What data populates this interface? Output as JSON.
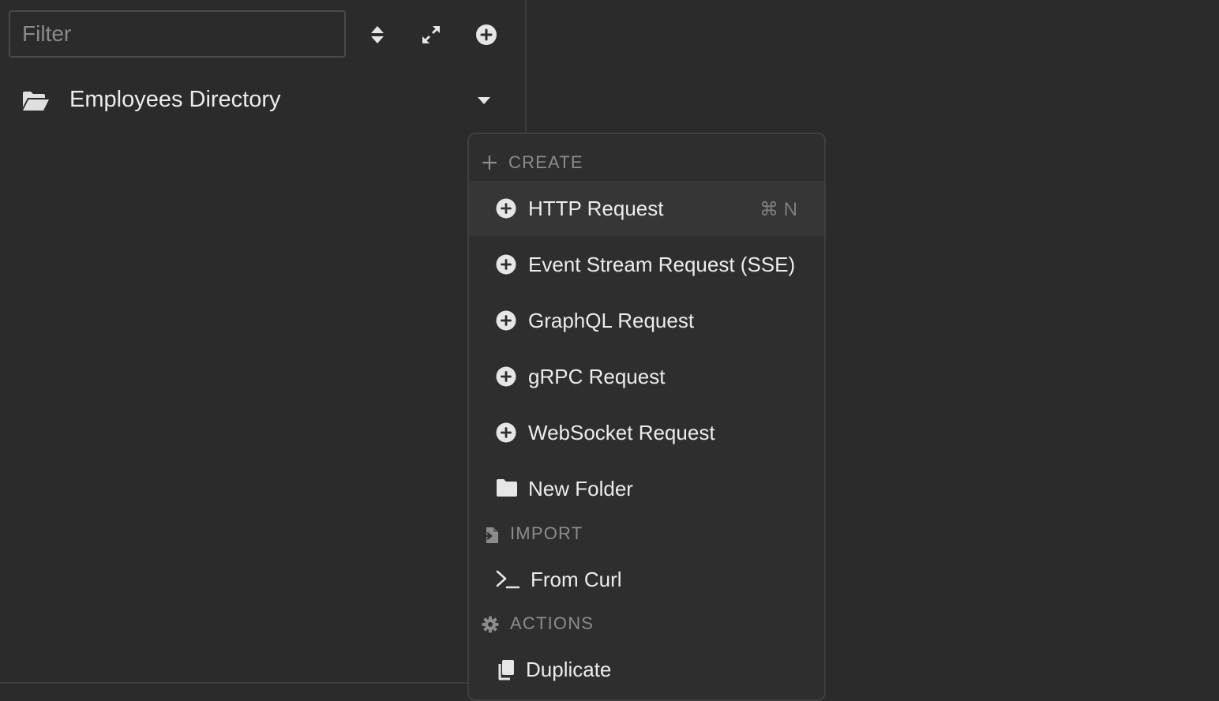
{
  "sidebar": {
    "filter_placeholder": "Filter",
    "toolbar": {
      "sort_icon": "sort-updown-icon",
      "expand_icon": "expand-arrows-icon",
      "add_icon": "plus-circle-icon"
    },
    "collection": {
      "icon": "folder-open-icon",
      "title": "Employees Directory",
      "toggle_icon": "caret-down-icon"
    }
  },
  "menu": {
    "create": {
      "label": "CREATE",
      "icon": "plus-icon",
      "items": [
        {
          "label": "HTTP Request",
          "icon": "plus-circle-icon",
          "shortcut": "⌘ N",
          "highlighted": true
        },
        {
          "label": "Event Stream Request (SSE)",
          "icon": "plus-circle-icon"
        },
        {
          "label": "GraphQL Request",
          "icon": "plus-circle-icon"
        },
        {
          "label": "gRPC Request",
          "icon": "plus-circle-icon"
        },
        {
          "label": "WebSocket Request",
          "icon": "plus-circle-icon"
        },
        {
          "label": "New Folder",
          "icon": "folder-icon"
        }
      ]
    },
    "import": {
      "label": "IMPORT",
      "icon": "file-import-icon",
      "items": [
        {
          "label": "From Curl",
          "icon": "terminal-icon"
        }
      ]
    },
    "actions": {
      "label": "ACTIONS",
      "icon": "gear-icon",
      "items": [
        {
          "label": "Duplicate",
          "icon": "copy-icon"
        }
      ]
    }
  },
  "colors": {
    "background": "#2b2b2b",
    "menu_background": "#2e2e2e",
    "highlight": "#363636",
    "text": "#ececec",
    "muted": "#8c8c8c"
  }
}
